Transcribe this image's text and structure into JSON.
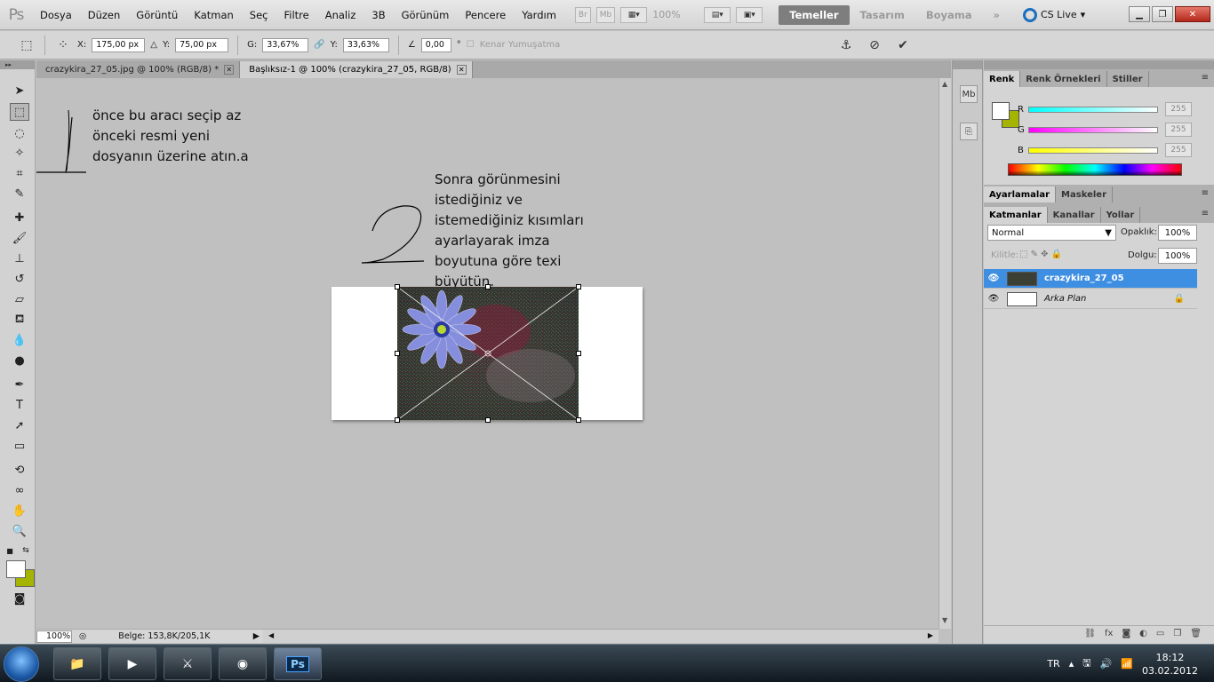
{
  "app": {
    "logo": "Ps"
  },
  "menu": [
    "Dosya",
    "Düzen",
    "Görüntü",
    "Katman",
    "Seç",
    "Filtre",
    "Analiz",
    "3B",
    "Görünüm",
    "Pencere",
    "Yardım"
  ],
  "menubar_icons": {
    "br": "Br",
    "mb": "Mb",
    "zoom": "100%"
  },
  "workspaces": [
    "Temeller",
    "Tasarım",
    "Boyama"
  ],
  "cslive": "CS Live",
  "options": {
    "x_label": "X:",
    "x_value": "175,00 px",
    "y_label": "Y:",
    "y_value": "75,00 px",
    "w_label": "G:",
    "w_value": "33,67%",
    "h_label": "Y:",
    "h_value": "33,63%",
    "angle_value": "0,00",
    "angle_unit": "°",
    "antialias_label": "Kenar Yumuşatma"
  },
  "tabs": [
    {
      "label": "crazykira_27_05.jpg @ 100% (RGB/8) *"
    },
    {
      "label": "Başlıksız-1 @ 100% (crazykira_27_05, RGB/8)"
    }
  ],
  "notes": {
    "step1": "önce bu aracı seçip az\nönceki resmi yeni\ndosyanın üzerine atın.a",
    "step2": "Sonra görünmesini\nistediğiniz ve\nistemediğiniz kısımları\nayarlayarak imza\nboyutuna göre texi\nbüyütün."
  },
  "status": {
    "zoom": "100%",
    "doc": "Belge: 153,8K/205,1K"
  },
  "color_panel": {
    "tabs": [
      "Renk",
      "Renk Örnekleri",
      "Stiller"
    ],
    "r_label": "R",
    "r_value": "255",
    "g_label": "G",
    "g_value": "255",
    "b_label": "B",
    "b_value": "255",
    "fg_color": "#ffffff",
    "bg_color": "#a4b400"
  },
  "adjust_panel": {
    "tabs": [
      "Ayarlamalar",
      "Maskeler"
    ]
  },
  "layers_panel": {
    "tabs": [
      "Katmanlar",
      "Kanallar",
      "Yollar"
    ],
    "blend_mode": "Normal",
    "opacity_label": "Opaklık:",
    "opacity_value": "100%",
    "lock_label": "Kilitle:",
    "fill_label": "Dolgu:",
    "fill_value": "100%",
    "layers": [
      {
        "name": "crazykira_27_05",
        "selected": true
      },
      {
        "name": "Arka Plan",
        "selected": false
      }
    ]
  },
  "taskbar": {
    "lang": "TR",
    "time": "18:12",
    "date": "03.02.2012",
    "ps_label": "Ps"
  }
}
